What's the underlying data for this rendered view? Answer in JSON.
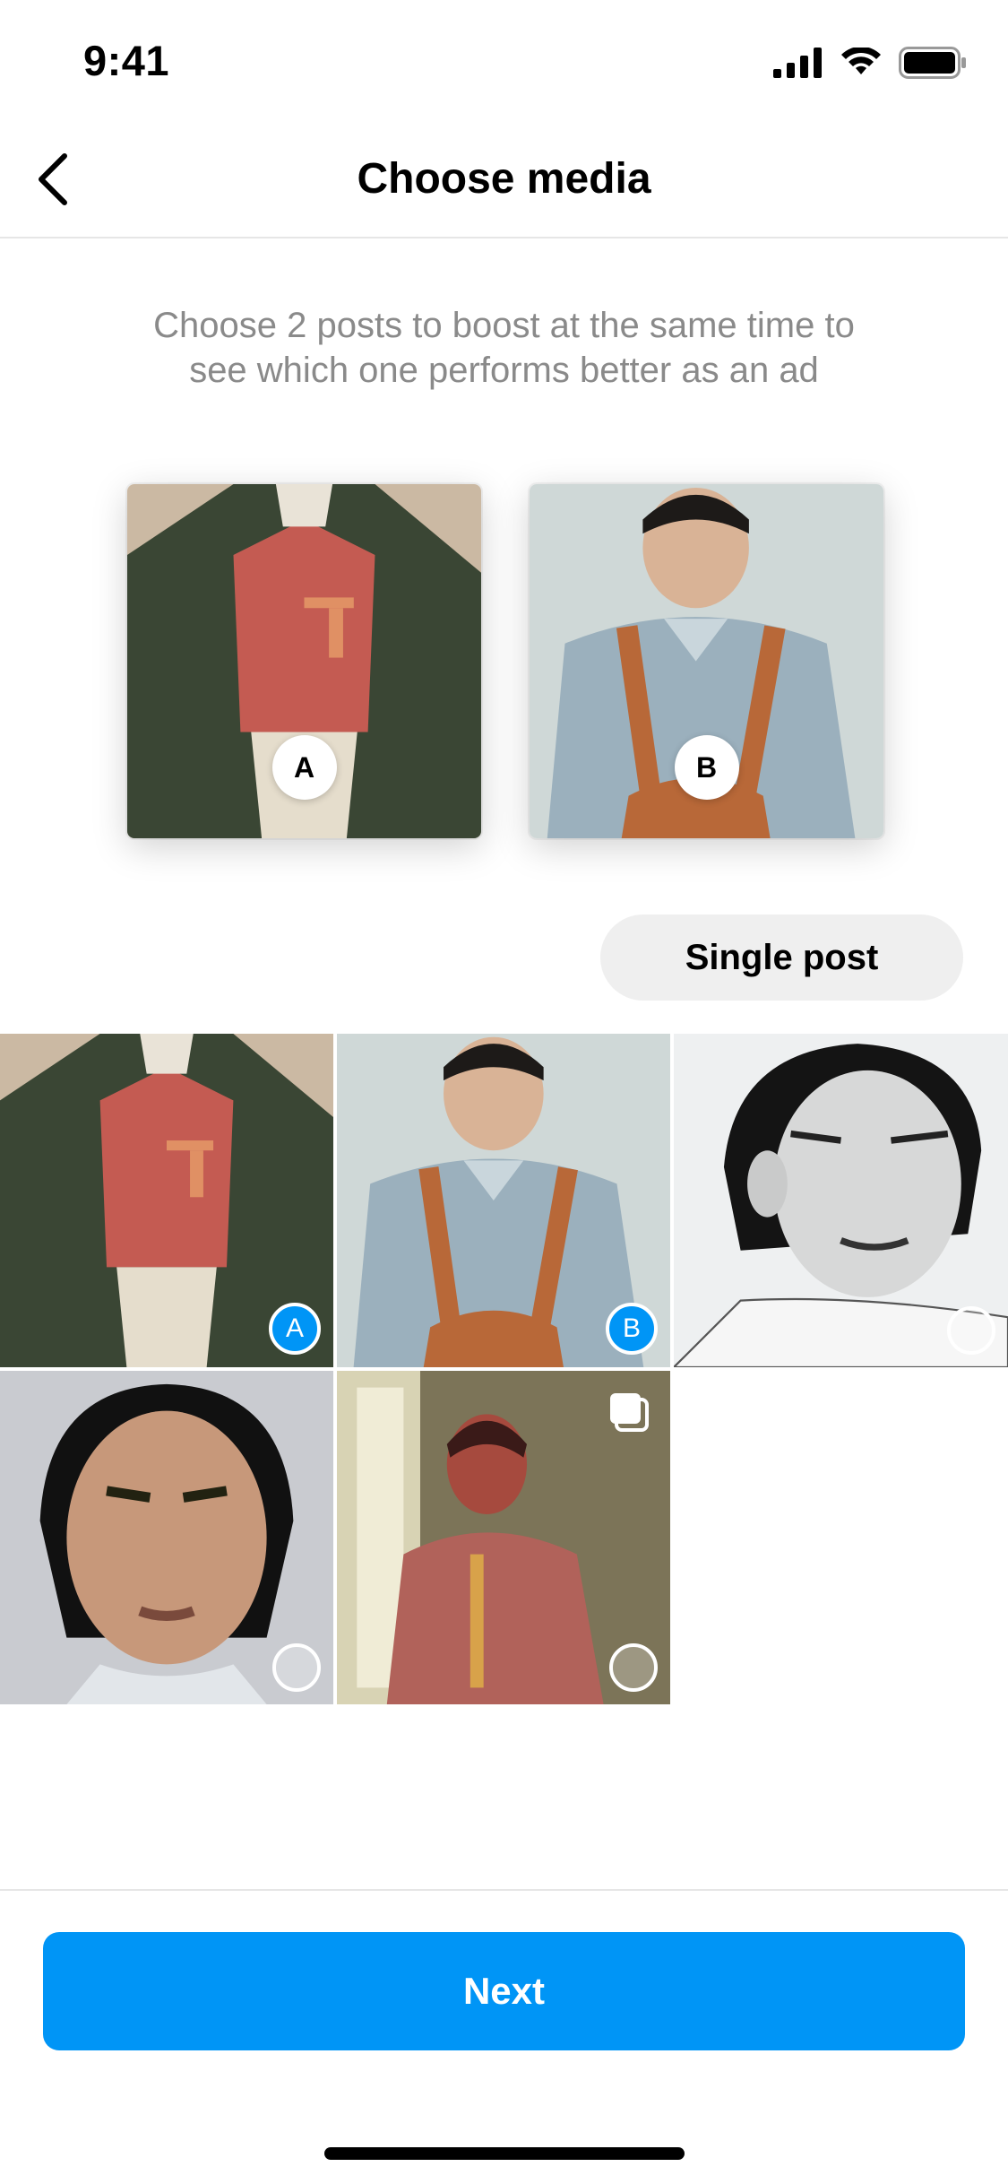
{
  "status_bar": {
    "time": "9:41",
    "icons": [
      "cellular-signal-icon",
      "wifi-icon",
      "battery-icon"
    ]
  },
  "nav": {
    "title": "Choose media",
    "back_icon": "chevron-left-icon"
  },
  "instruction": {
    "line1": "Choose 2 posts to boost at the same time to",
    "line2": "see which one performs better as an ad"
  },
  "preview": {
    "a": {
      "label": "A"
    },
    "b": {
      "label": "B"
    }
  },
  "single_post_button": {
    "label": "Single post"
  },
  "grid": {
    "tiles": [
      {
        "selected": true,
        "selection_label": "A"
      },
      {
        "selected": true,
        "selection_label": "B"
      },
      {
        "selected": false
      },
      {
        "selected": false
      },
      {
        "selected": false,
        "carousel_icon": "multiple-posts-icon"
      }
    ]
  },
  "next_button": {
    "label": "Next"
  },
  "colors": {
    "accent": "#0095f6",
    "secondary_button_bg": "#efefef",
    "instruction_text": "#8a8a8a",
    "divider": "#e6e6e6"
  }
}
